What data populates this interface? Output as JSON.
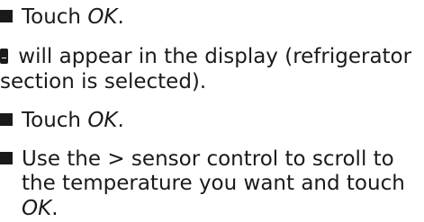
{
  "steps": [
    {
      "type": "bullet",
      "prefix": "Touch ",
      "emphasis": "OK",
      "suffix": "."
    },
    {
      "type": "icon-text",
      "icon": "refrigerator-icon",
      "line1": " will appear in the display (refrigerator",
      "line2": "section is selected)."
    },
    {
      "type": "bullet",
      "prefix": "Touch ",
      "emphasis": "OK",
      "suffix": "."
    },
    {
      "type": "bullet",
      "line1_prefix": "Use the ",
      "arrow": ">",
      "line1_suffix": " sensor control to scroll to",
      "line2": "the temperature you want and touch",
      "line3_emphasis": "OK",
      "line3_suffix": "."
    }
  ]
}
